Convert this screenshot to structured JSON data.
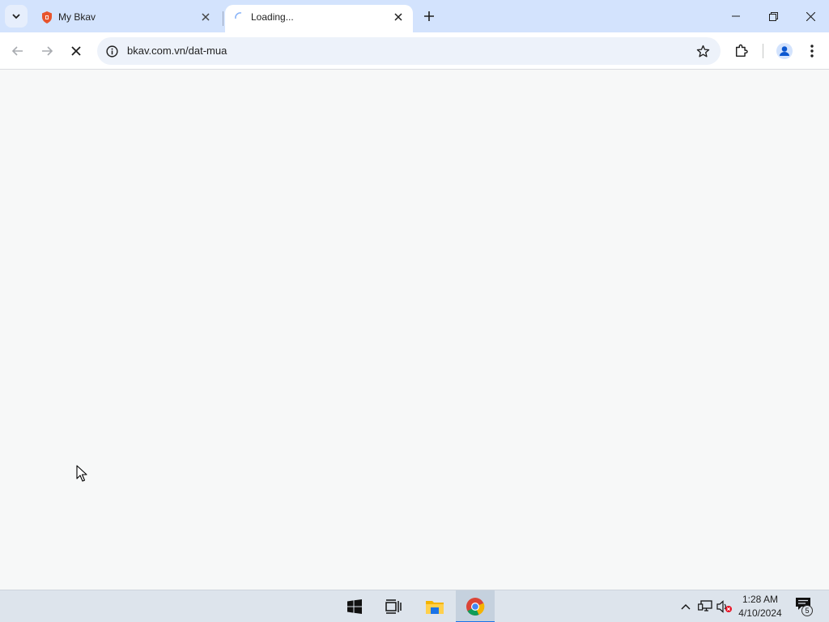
{
  "browser": {
    "tabs": [
      {
        "title": "My Bkav",
        "favicon": "bkav-shield-icon",
        "active": false
      },
      {
        "title": "Loading...",
        "favicon": "loading-spinner-icon",
        "active": true
      }
    ],
    "address_bar": {
      "url": "bkav.com.vn/dat-mua",
      "site_info_icon": "info-icon"
    },
    "loading": true,
    "accent_color": "#d3e3fd"
  },
  "window_controls": [
    "minimize",
    "restore",
    "close"
  ],
  "taskbar": {
    "apps": [
      "windows-start-icon",
      "task-view-icon",
      "file-explorer-icon",
      "chrome-icon"
    ],
    "active_app": "chrome-icon",
    "tray": [
      "chevron-up-icon",
      "network-icon",
      "volume-muted-icon"
    ],
    "clock": {
      "time": "1:28 AM",
      "date": "4/10/2024"
    },
    "notifications": {
      "count": "5"
    }
  }
}
